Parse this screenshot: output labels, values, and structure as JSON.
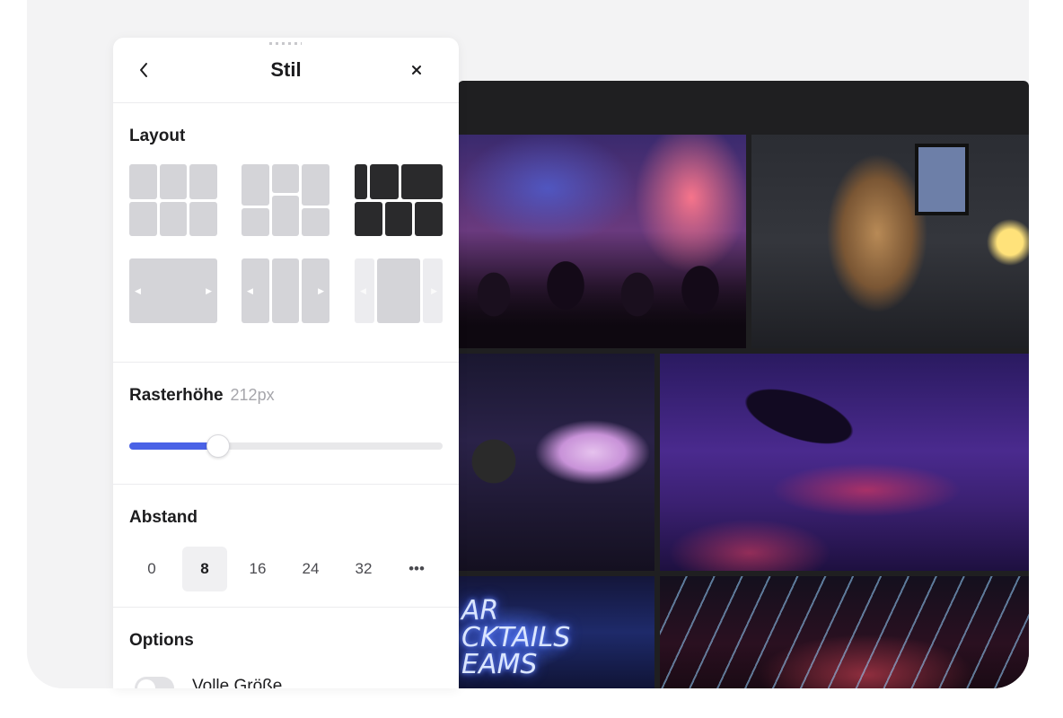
{
  "panel": {
    "title": "Stil",
    "back_icon": "chevron-left-icon",
    "close_icon": "close-icon"
  },
  "layout": {
    "heading": "Layout",
    "options": [
      {
        "name": "grid-3x2",
        "selected": false
      },
      {
        "name": "grid-masonry",
        "selected": false
      },
      {
        "name": "grid-mixed",
        "selected": true
      },
      {
        "name": "slider-single",
        "selected": false
      },
      {
        "name": "slider-triple",
        "selected": false
      },
      {
        "name": "slider-peek",
        "selected": false
      }
    ]
  },
  "grid_height": {
    "heading": "Rasterhöhe",
    "value": "212px",
    "slider_level": 0.28
  },
  "spacing": {
    "heading": "Abstand",
    "options": [
      "0",
      "8",
      "16",
      "24",
      "32",
      "•••"
    ],
    "selected": "8"
  },
  "options": {
    "heading": "Options",
    "toggle_label": "Volle Größe",
    "toggle_on": false
  },
  "gallery": {
    "neon_text": "AR\nCKTAILS\nEAMS"
  },
  "colors": {
    "accent": "#4a62e6",
    "selected_layout": "#2a2a2c",
    "stage_bg": "#f3f3f4"
  }
}
